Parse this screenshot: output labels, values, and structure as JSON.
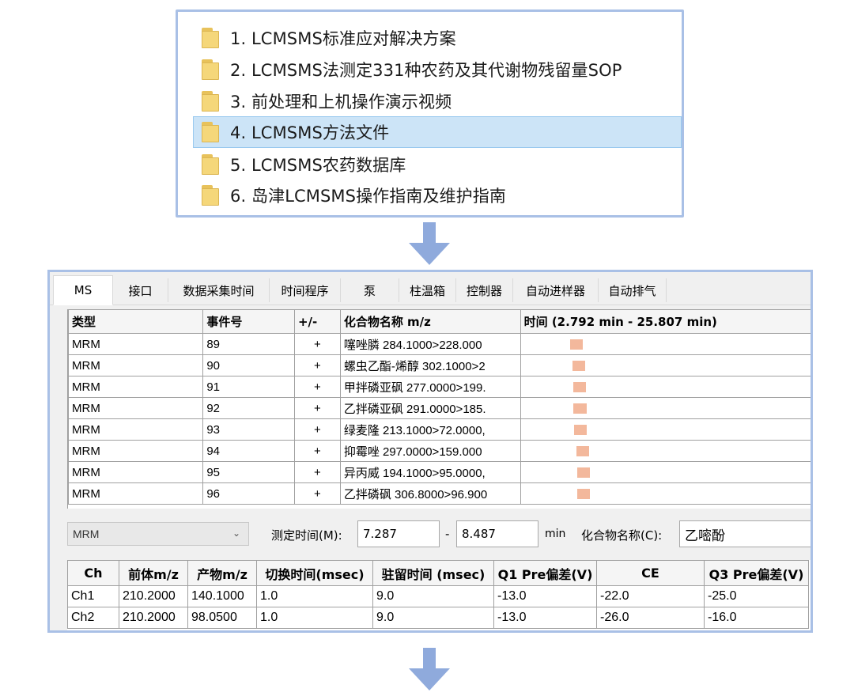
{
  "folders": [
    {
      "label": "1. LCMSMS标准应对解决方案"
    },
    {
      "label": "2. LCMSMS法测定331种农药及其代谢物残留量SOP"
    },
    {
      "label": "3. 前处理和上机操作演示视频"
    },
    {
      "label": "4. LCMSMS方法文件",
      "selected": true
    },
    {
      "label": "5. LCMSMS农药数据库"
    },
    {
      "label": "6. 岛津LCMSMS操作指南及维护指南"
    }
  ],
  "tabs": [
    "MS",
    "接口",
    "数据采集时间",
    "时间程序",
    "泵",
    "柱温箱",
    "控制器",
    "自动进样器",
    "自动排气"
  ],
  "event_table": {
    "headers": [
      "类型",
      "事件号",
      "+/-",
      "化合物名称 m/z",
      "时间 (2.792 min - 25.807 min)"
    ],
    "time_range_min": [
      2.792,
      25.807
    ],
    "rows": [
      {
        "type": "MRM",
        "event": "89",
        "pm": "+",
        "compound": "噻唑膦 284.1000>228.000",
        "start": 6.65,
        "end": 7.65
      },
      {
        "type": "MRM",
        "event": "90",
        "pm": "+",
        "compound": "螺虫乙酯-烯醇 302.1000>2",
        "start": 6.85,
        "end": 7.85
      },
      {
        "type": "MRM",
        "event": "91",
        "pm": "+",
        "compound": "甲拌磷亚砜 277.0000>199.",
        "start": 6.9,
        "end": 7.9
      },
      {
        "type": "MRM",
        "event": "92",
        "pm": "+",
        "compound": "乙拌磷亚砜 291.0000>185.",
        "start": 6.95,
        "end": 7.95
      },
      {
        "type": "MRM",
        "event": "93",
        "pm": "+",
        "compound": "绿麦隆 213.1000>72.0000,",
        "start": 7.0,
        "end": 8.0
      },
      {
        "type": "MRM",
        "event": "94",
        "pm": "+",
        "compound": "抑霉唑 297.0000>159.000",
        "start": 7.15,
        "end": 8.15
      },
      {
        "type": "MRM",
        "event": "95",
        "pm": "+",
        "compound": "异丙威 194.1000>95.0000,",
        "start": 7.2,
        "end": 8.2
      },
      {
        "type": "MRM",
        "event": "96",
        "pm": "+",
        "compound": "乙拌磷砜 306.8000>96.900",
        "start": 7.25,
        "end": 8.25
      }
    ]
  },
  "form": {
    "mode": "MRM",
    "time_label": "测定时间(M):",
    "time_start": "7.287",
    "dash": "-",
    "time_end": "8.487",
    "unit": "min",
    "compound_label": "化合物名称(C):",
    "compound_value": "乙嘧酚"
  },
  "channel_table": {
    "headers": [
      "Ch",
      "前体m/z",
      "产物m/z",
      "切换时间(msec)",
      "驻留时间 (msec)",
      "Q1 Pre偏差(V)",
      "CE",
      "Q3 Pre偏差(V)"
    ],
    "rows": [
      [
        "Ch1",
        "210.2000",
        "140.1000",
        "1.0",
        "9.0",
        "-13.0",
        "-22.0",
        "-25.0"
      ],
      [
        "Ch2",
        "210.2000",
        "98.0500",
        "1.0",
        "9.0",
        "-13.0",
        "-26.0",
        "-16.0"
      ]
    ]
  },
  "colors": {
    "panel_border": "#a9c0e6",
    "selection": "#cce4f7",
    "arrow": "#8faadc",
    "timeline_bar": "#f3b89c"
  }
}
